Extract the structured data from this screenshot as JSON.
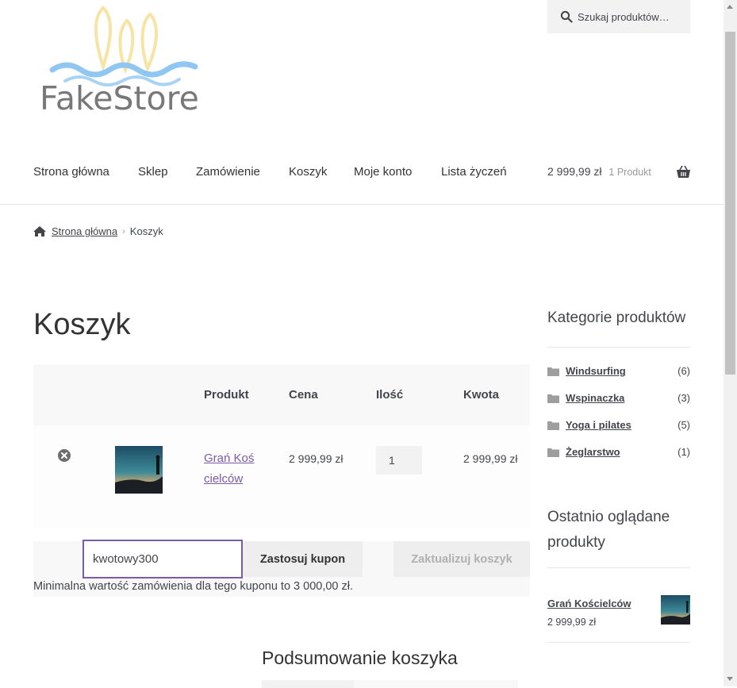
{
  "brand": {
    "name": "FakeStore"
  },
  "search": {
    "placeholder": "Szukaj produktów…"
  },
  "nav": {
    "items": [
      "Strona główna",
      "Sklep",
      "Zamówienie",
      "Koszyk",
      "Moje konto",
      "Lista życzeń"
    ]
  },
  "mini_cart": {
    "amount": "2 999,99 zł",
    "count": "1 Produkt"
  },
  "breadcrumb": {
    "home": "Strona główna",
    "current": "Koszyk"
  },
  "page": {
    "title": "Koszyk"
  },
  "cart": {
    "headers": {
      "product": "Produkt",
      "price": "Cena",
      "quantity": "Ilość",
      "subtotal": "Kwota"
    },
    "item": {
      "name": "Grań Kościelców",
      "price": "2 999,99 zł",
      "quantity": "1",
      "subtotal": "2 999,99 zł"
    },
    "coupon_value": "kwotowy300",
    "apply_label": "Zastosuj kupon",
    "update_label": "Zaktualizuj koszyk",
    "coupon_message": "Minimalna wartość zamówienia dla tego kuponu to 3 000,00 zł.",
    "totals_title": "Podsumowanie koszyka"
  },
  "sidebar": {
    "categories_title": "Kategorie produktów",
    "categories": [
      {
        "name": "Windsurfing",
        "count": "(6)"
      },
      {
        "name": "Wspinaczka",
        "count": "(3)"
      },
      {
        "name": "Yoga i pilates",
        "count": "(5)"
      },
      {
        "name": "Żeglarstwo",
        "count": "(1)"
      }
    ],
    "recent_title": "Ostatnio oglądane produkty",
    "recent": {
      "name": "Grań Kościelców",
      "price": "2 999,99 zł"
    }
  },
  "colors": {
    "accent": "#7b5aa6",
    "text": "#43454b",
    "muted_bg": "#f8f8f8"
  }
}
